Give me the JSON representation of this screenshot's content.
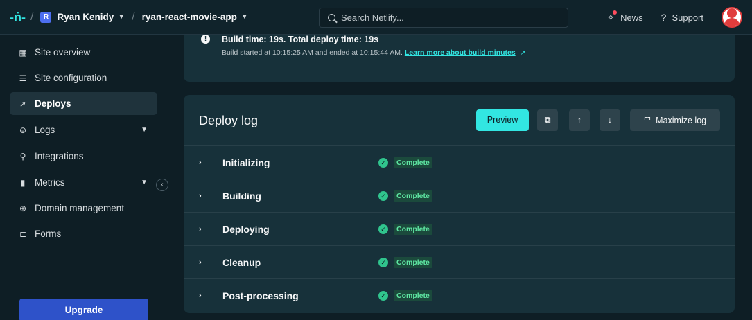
{
  "topbar": {
    "team_initial": "R",
    "team_name": "Ryan Kenidy",
    "site_name": "ryan-react-movie-app",
    "search_placeholder": "Search Netlify...",
    "news_label": "News",
    "support_label": "Support"
  },
  "sidebar": {
    "items": [
      {
        "label": "Site overview",
        "icon": "grid-icon"
      },
      {
        "label": "Site configuration",
        "icon": "server-icon"
      },
      {
        "label": "Deploys",
        "icon": "rocket-icon"
      },
      {
        "label": "Logs",
        "icon": "logs-icon"
      },
      {
        "label": "Integrations",
        "icon": "plug-icon"
      },
      {
        "label": "Metrics",
        "icon": "bar-chart-icon"
      },
      {
        "label": "Domain management",
        "icon": "globe-icon"
      },
      {
        "label": "Forms",
        "icon": "forms-icon"
      }
    ],
    "upgrade_label": "Upgrade"
  },
  "build_info": {
    "title": "Build time: 19s. Total deploy time: 19s",
    "subtitle": "Build started at 10:15:25 AM and ended at 10:15:44 AM.",
    "link_text": "Learn more about build minutes"
  },
  "deploy_log": {
    "title": "Deploy log",
    "preview_label": "Preview",
    "maximize_label": "Maximize log",
    "rows": [
      {
        "label": "Initializing",
        "status": "Complete"
      },
      {
        "label": "Building",
        "status": "Complete"
      },
      {
        "label": "Deploying",
        "status": "Complete"
      },
      {
        "label": "Cleanup",
        "status": "Complete"
      },
      {
        "label": "Post-processing",
        "status": "Complete"
      }
    ]
  },
  "colors": {
    "accent": "#32e6e2",
    "success": "#30c48d",
    "upgrade": "#2e52c9"
  }
}
